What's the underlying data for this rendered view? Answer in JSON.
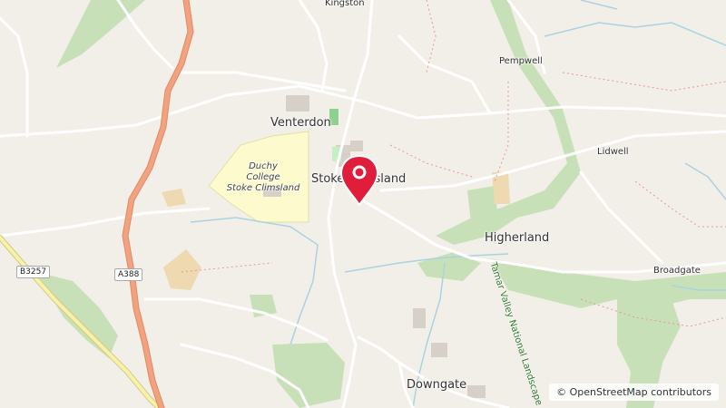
{
  "map": {
    "places": {
      "kingston": "Kingston",
      "pempwell": "Pempwell",
      "venterdon": "Venterdon",
      "stoke_climsland": "Stoke Climsland",
      "lidwell": "Lidwell",
      "higherland": "Higherland",
      "broadgate": "Broadgate",
      "downgate": "Downgate"
    },
    "institution": {
      "line1": "Duchy",
      "line2": "College",
      "line3": "Stoke Climsland"
    },
    "roads": {
      "a_road": "A388",
      "b_road": "B3257"
    },
    "park": "Tamar Valley National Landscape",
    "marker_icon": "map-pin-icon",
    "colors": {
      "background": "#f2efe9",
      "a_road": "#f3a27f",
      "b_road": "#f7f3a6",
      "forest": "#add19e",
      "marker": "#e01e3c",
      "water": "#aad3df"
    }
  },
  "attribution": "© OpenStreetMap contributors"
}
